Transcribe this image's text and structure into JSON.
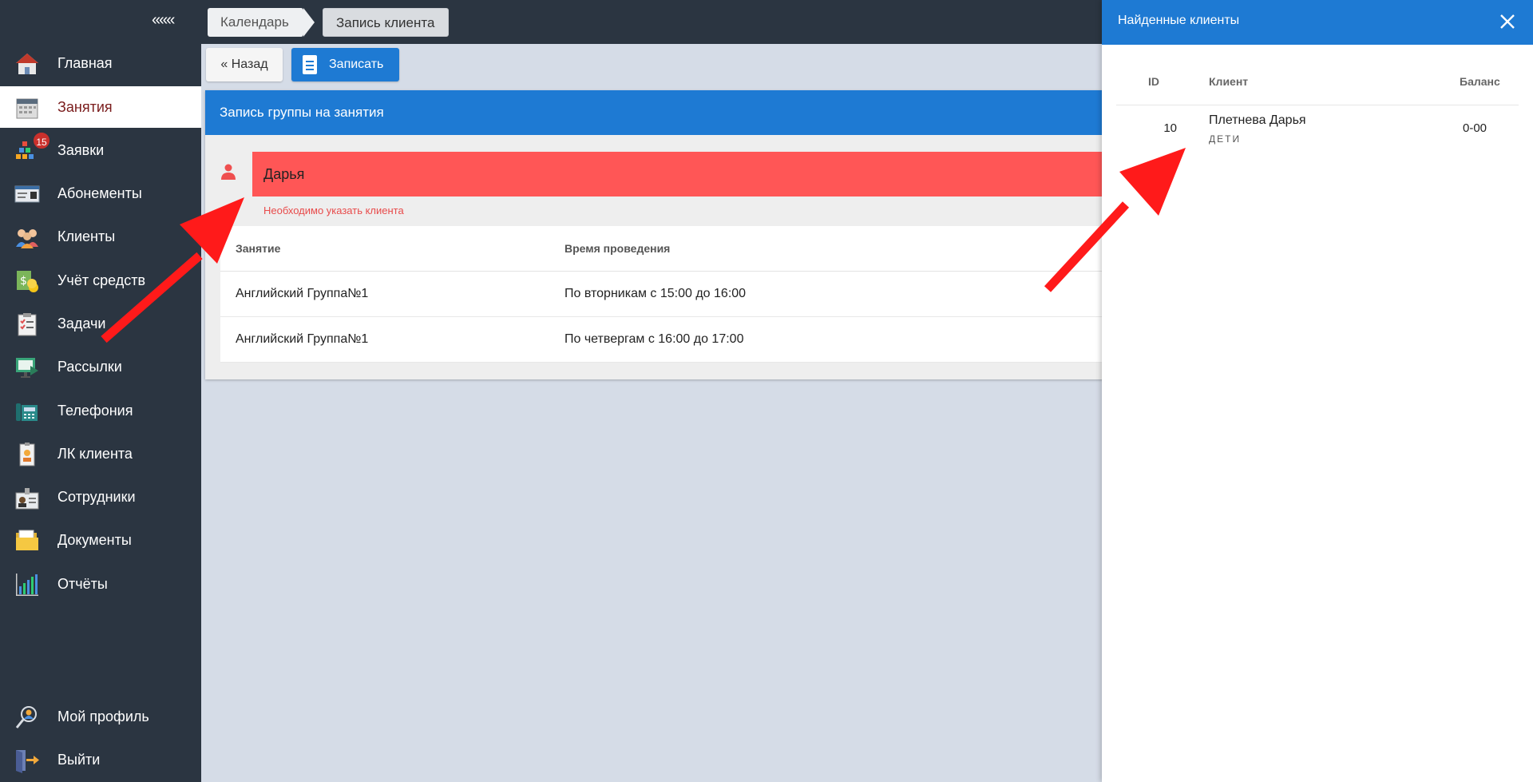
{
  "sidebar": {
    "collapse_label": "«««",
    "items": [
      {
        "label": "Главная",
        "icon": "home-icon"
      },
      {
        "label": "Занятия",
        "icon": "calendar-icon",
        "active": true
      },
      {
        "label": "Заявки",
        "icon": "requests-icon",
        "badge": "15"
      },
      {
        "label": "Абонементы",
        "icon": "subscription-card-icon"
      },
      {
        "label": "Клиенты",
        "icon": "clients-icon"
      },
      {
        "label": "Учёт средств",
        "icon": "money-icon"
      },
      {
        "label": "Задачи",
        "icon": "tasks-checklist-icon"
      },
      {
        "label": "Рассылки",
        "icon": "mailing-icon"
      },
      {
        "label": "Телефония",
        "icon": "telephone-icon"
      },
      {
        "label": "ЛК клиента",
        "icon": "client-account-icon"
      },
      {
        "label": "Сотрудники",
        "icon": "staff-icon"
      },
      {
        "label": "Документы",
        "icon": "documents-folder-icon"
      },
      {
        "label": "Отчёты",
        "icon": "reports-chart-icon"
      },
      {
        "label": "Мой профиль",
        "icon": "profile-icon"
      },
      {
        "label": "Выйти",
        "icon": "logout-door-icon"
      }
    ]
  },
  "breadcrumbs": [
    "Календарь",
    "Запись клиента"
  ],
  "toolbar": {
    "back_label": "« Назад",
    "record_label": "Записать"
  },
  "form": {
    "title": "Запись группы на занятия",
    "client_value": "Дарья",
    "error_text": "Необходимо указать клиента",
    "columns": [
      "Занятие",
      "Время проведения"
    ],
    "rows": [
      {
        "lesson": "Английский Группа№1",
        "time": "По вторникам с 15:00 до 16:00"
      },
      {
        "lesson": "Английский Группа№1",
        "time": "По четвергам с 16:00 до 17:00"
      }
    ]
  },
  "panel": {
    "title": "Найденные клиенты",
    "columns": {
      "id": "ID",
      "client": "Клиент",
      "balance": "Баланс"
    },
    "results": [
      {
        "id": "10",
        "name": "Плетнева Дарья",
        "group": "ДЕТИ",
        "balance": "0-00"
      }
    ]
  },
  "colors": {
    "sidebar_bg": "#2b3541",
    "accent": "#1e7ad3",
    "error": "#ff5656",
    "arrow": "#ff1a1a"
  }
}
